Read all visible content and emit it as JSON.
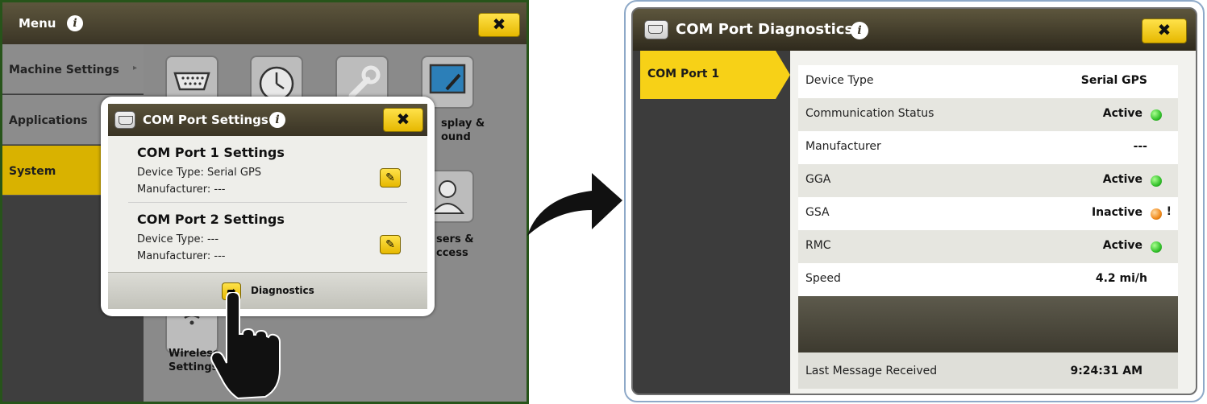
{
  "left": {
    "title": "Menu",
    "close_label": "✖",
    "sidebar": [
      {
        "label": "Machine Settings",
        "chevron": "▸"
      },
      {
        "label": "Applications"
      },
      {
        "label": "System"
      }
    ],
    "tiles": [
      {
        "label": "Display &\nSound",
        "visible": "splay &\nound"
      },
      {
        "label": "Users &\nAccess",
        "visible": "sers &\nccess"
      },
      {
        "label": "Wireless\nSettings",
        "visible": "Wireless\nSettings"
      }
    ],
    "dialog": {
      "title": "COM Port Settings",
      "close_label": "✖",
      "port1": {
        "title": "COM Port 1 Settings",
        "device_type": "Device Type: Serial GPS",
        "manufacturer": "Manufacturer: ---"
      },
      "port2": {
        "title": "COM Port 2 Settings",
        "device_type": "Device Type: ---",
        "manufacturer": "Manufacturer: ---"
      },
      "diagnostics_label": "Diagnostics"
    }
  },
  "right": {
    "title": "COM Port Diagnostics",
    "close_label": "✖",
    "tab_label": "COM Port 1",
    "rows": [
      {
        "label": "Device Type",
        "value": "Serial GPS",
        "status": ""
      },
      {
        "label": "Communication Status",
        "value": "Active",
        "status": "green"
      },
      {
        "label": "Manufacturer",
        "value": "---",
        "status": ""
      },
      {
        "label": "GGA",
        "value": "Active",
        "status": "green"
      },
      {
        "label": "GSA",
        "value": "Inactive",
        "status": "orange",
        "mark": "!"
      },
      {
        "label": "RMC",
        "value": "Active",
        "status": "green"
      },
      {
        "label": "Speed",
        "value": "4.2 mi/h",
        "status": ""
      }
    ],
    "last_message_label": "Last Message Received",
    "last_message_value": "9:24:31 AM"
  },
  "colors": {
    "status_green": "#33c12b",
    "status_orange": "#f08a1c",
    "accent_yellow": "#f7d117"
  }
}
